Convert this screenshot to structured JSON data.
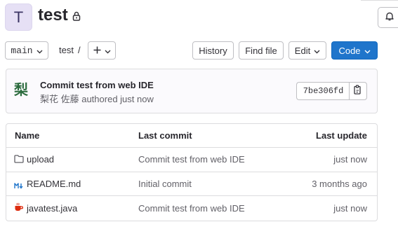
{
  "project": {
    "avatar_letter": "T",
    "name": "test",
    "visibility_icon": "lock-icon"
  },
  "toolbar": {
    "branch": "main",
    "breadcrumb_root": "test",
    "breadcrumb_sep": "/",
    "add_icon": "plus-icon",
    "history_label": "History",
    "find_file_label": "Find file",
    "edit_label": "Edit",
    "code_label": "Code"
  },
  "commit": {
    "title": "Commit test from web IDE",
    "author_meta": "梨花 佐藤 authored just now",
    "avatar_glyph": "梨",
    "sha": "7be306fd",
    "copy_icon": "copy-icon"
  },
  "table": {
    "headers": {
      "name": "Name",
      "last_commit": "Last commit",
      "last_update": "Last update"
    },
    "rows": [
      {
        "icon": "folder-icon",
        "name": "upload",
        "last_commit": "Commit test from web IDE",
        "last_update": "just now"
      },
      {
        "icon": "markdown-icon",
        "name": "README.md",
        "last_commit": "Initial commit",
        "last_update": "3 months ago"
      },
      {
        "icon": "java-icon",
        "name": "javatest.java",
        "last_commit": "Commit test from web IDE",
        "last_update": "just now"
      }
    ]
  },
  "colors": {
    "primary": "#1f75cb",
    "avatar_bg": "#e6e0f5",
    "border": "#dcdcde"
  }
}
